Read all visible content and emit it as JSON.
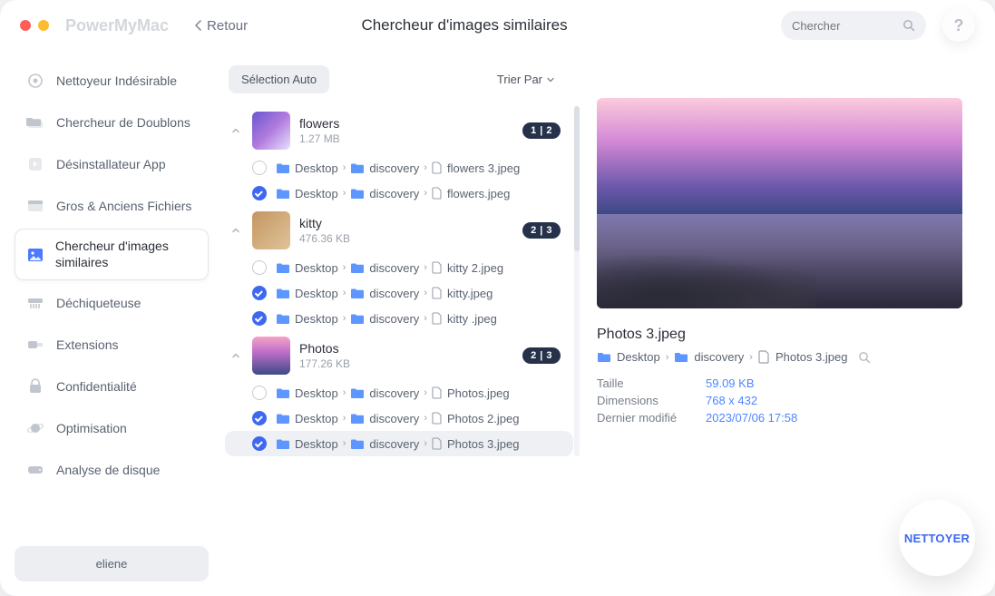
{
  "brand": "PowerMyMac",
  "back_label": "Retour",
  "title": "Chercheur d'images similaires",
  "search_placeholder": "Chercher",
  "help_label": "?",
  "sidebar": {
    "items": [
      {
        "label": "Nettoyeur Indésirable",
        "icon": "broom-icon"
      },
      {
        "label": "Chercheur de Doublons",
        "icon": "folders-icon"
      },
      {
        "label": "Désinstallateur App",
        "icon": "app-icon"
      },
      {
        "label": "Gros & Anciens Fichiers",
        "icon": "box-icon"
      },
      {
        "label": "Chercheur d'images similaires",
        "icon": "image-icon"
      },
      {
        "label": "Déchiqueteuse",
        "icon": "shredder-icon"
      },
      {
        "label": "Extensions",
        "icon": "plug-icon"
      },
      {
        "label": "Confidentialité",
        "icon": "lock-icon"
      },
      {
        "label": "Optimisation",
        "icon": "planet-icon"
      },
      {
        "label": "Analyse de disque",
        "icon": "disk-icon"
      }
    ],
    "user": "eliene"
  },
  "toolbar": {
    "auto_select": "Sélection Auto",
    "sort_by": "Trier Par"
  },
  "groups": [
    {
      "name": "flowers",
      "size": "1.27 MB",
      "badge": "1 | 2",
      "thumbClass": "th_flowers",
      "rows": [
        {
          "checked": false,
          "p1": "Desktop",
          "p2": "discovery",
          "file": "flowers 3.jpeg"
        },
        {
          "checked": true,
          "p1": "Desktop",
          "p2": "discovery",
          "file": "flowers.jpeg"
        }
      ]
    },
    {
      "name": "kitty",
      "size": "476.36 KB",
      "badge": "2 | 3",
      "thumbClass": "th_kitty",
      "rows": [
        {
          "checked": false,
          "p1": "Desktop",
          "p2": "discovery",
          "file": "kitty 2.jpeg"
        },
        {
          "checked": true,
          "p1": "Desktop",
          "p2": "discovery",
          "file": "kitty.jpeg"
        },
        {
          "checked": true,
          "p1": "Desktop",
          "p2": "discovery",
          "file": "kitty .jpeg"
        }
      ]
    },
    {
      "name": "Photos",
      "size": "177.26 KB",
      "badge": "2 | 3",
      "thumbClass": "th_photos",
      "rows": [
        {
          "checked": false,
          "p1": "Desktop",
          "p2": "discovery",
          "file": "Photos.jpeg"
        },
        {
          "checked": true,
          "p1": "Desktop",
          "p2": "discovery",
          "file": "Photos 2.jpeg"
        },
        {
          "checked": true,
          "p1": "Desktop",
          "p2": "discovery",
          "file": "Photos 3.jpeg",
          "selected": true
        }
      ]
    }
  ],
  "preview": {
    "name": "Photos 3.jpeg",
    "path": {
      "p1": "Desktop",
      "p2": "discovery",
      "file": "Photos 3.jpeg"
    },
    "meta": {
      "size_label": "Taille",
      "size_val": "59.09 KB",
      "dim_label": "Dimensions",
      "dim_val": "768 x 432",
      "mod_label": "Dernier modifié",
      "mod_val": "2023/07/06 17:58"
    }
  },
  "clean_label": "NETTOYER",
  "sep": "›"
}
